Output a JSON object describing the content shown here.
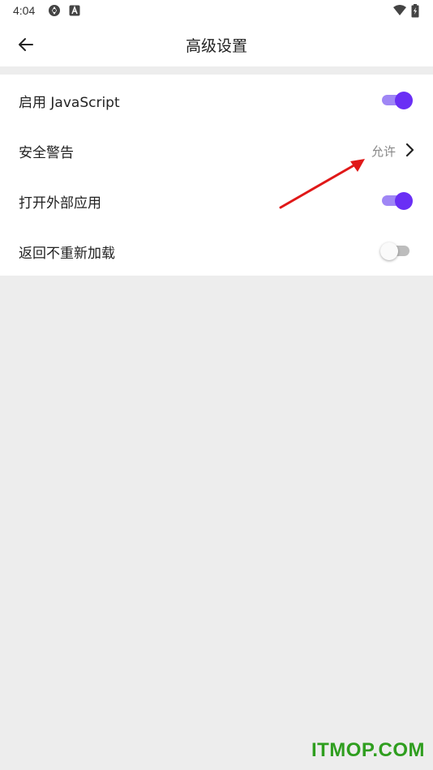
{
  "status_bar": {
    "time": "4:04",
    "icons": [
      "sync-icon",
      "a-box-icon",
      "wifi-icon",
      "battery-charging-icon"
    ]
  },
  "app_bar": {
    "title": "高级设置",
    "back_icon": "back-arrow-icon"
  },
  "settings": {
    "items": [
      {
        "label": "启用 JavaScript",
        "control": "toggle",
        "on": true
      },
      {
        "label": "安全警告",
        "control": "link",
        "value": "允许"
      },
      {
        "label": "打开外部应用",
        "control": "toggle",
        "on": true
      },
      {
        "label": "返回不重新加载",
        "control": "toggle",
        "on": false
      }
    ]
  },
  "colors": {
    "accent": "#6a2ff5",
    "accent_track": "#9f86f5",
    "background": "#ededed",
    "annotation": "#e01818",
    "watermark": "#2f9e1f"
  },
  "watermark": "ITMOP.COM"
}
